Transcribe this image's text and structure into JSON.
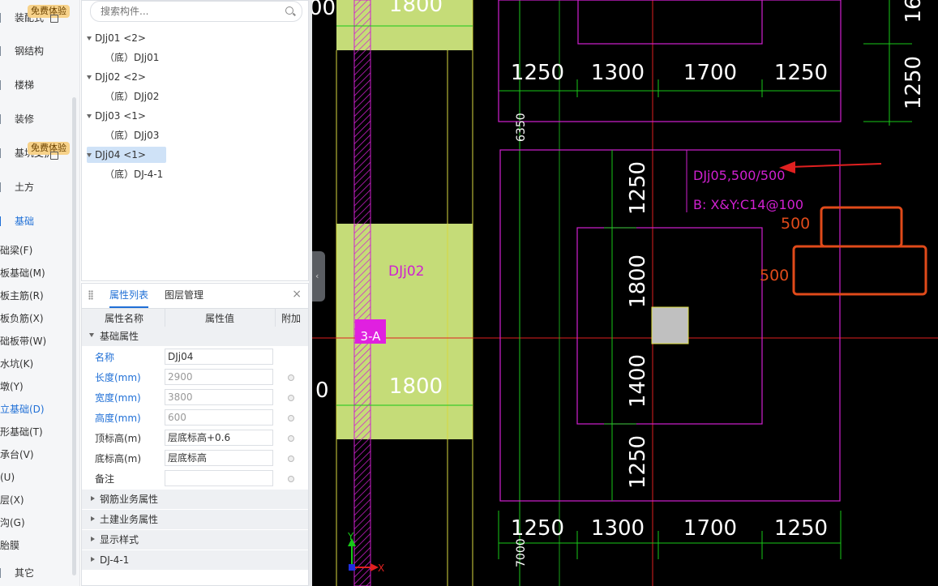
{
  "nav": {
    "items": [
      {
        "label": "装配式",
        "badge": "免费体验"
      },
      {
        "label": "钢结构"
      },
      {
        "label": "楼梯"
      },
      {
        "label": "装修"
      },
      {
        "label": "基坑支护",
        "badge": "免费体验"
      },
      {
        "label": "土方"
      },
      {
        "label": "基础",
        "active": true
      }
    ],
    "sub_items": [
      "础梁(F)",
      "板基础(M)",
      "板主筋(R)",
      "板负筋(X)",
      "础板带(W)",
      "水坑(K)",
      "墩(Y)",
      "立基础(D)",
      "形基础(T)",
      "承台(V)",
      "(U)",
      "层(X)",
      "沟(G)",
      "胎膜"
    ],
    "bottom_item": "其它"
  },
  "tree": {
    "search_placeholder": "搜索构件...",
    "nodes": [
      {
        "label": "DJj01 <2>",
        "child": "（底）DJj01"
      },
      {
        "label": "DJj02 <2>",
        "child": "（底）DJj02"
      },
      {
        "label": "DJj03 <1>",
        "child": "（底）DJj03"
      },
      {
        "label": "DJj04 <1>",
        "child": "（底）DJ-4-1",
        "selected": true
      }
    ]
  },
  "props": {
    "tabs": [
      "属性列表",
      "图层管理"
    ],
    "columns": [
      "属性名称",
      "属性值",
      "附加"
    ],
    "group_main": "基础属性",
    "rows": [
      {
        "name": "名称",
        "value": "DJj04"
      },
      {
        "name": "长度(mm)",
        "value": "2900"
      },
      {
        "name": "宽度(mm)",
        "value": "3800"
      },
      {
        "name": "高度(mm)",
        "value": "600"
      },
      {
        "name": "顶标高(m)",
        "value": "层底标高+0.6"
      },
      {
        "name": "底标高(m)",
        "value": "层底标高"
      },
      {
        "name": "备注",
        "value": ""
      }
    ],
    "groups": [
      "钢筋业务属性",
      "土建业务属性",
      "显示样式",
      "DJ-4-1"
    ]
  },
  "cad": {
    "top_dims": [
      "1250",
      "1300",
      "1700",
      "1250"
    ],
    "bottom_dims": [
      "1250",
      "1300",
      "1700",
      "1250"
    ],
    "vert_dims": [
      "1250",
      "1800",
      "1400",
      "1250"
    ],
    "right_dim": "1250",
    "right_top_dim": "16",
    "left_dim_top": "1800",
    "left_dim_bottom": "1800",
    "left_edge_top": "00",
    "left_edge_bottom": "0",
    "label_6350": "6350",
    "label_7000": "7000",
    "djj02_label": "DJj02",
    "grid_tag": "3-A",
    "annotation_line1": "DJj05,500/500",
    "annotation_line2": "B:  X&Y:C14@100",
    "markup_500_upper": "500",
    "markup_500_lower": "500",
    "axis_y": "Y",
    "axis_x": "X",
    "colors": {
      "magenta": "#d020d0",
      "green": "#18c818",
      "yellow": "#d8d840",
      "red": "#e02020",
      "lime_fill": "#c5dc78",
      "orange_markup": "#e04a1a"
    }
  }
}
